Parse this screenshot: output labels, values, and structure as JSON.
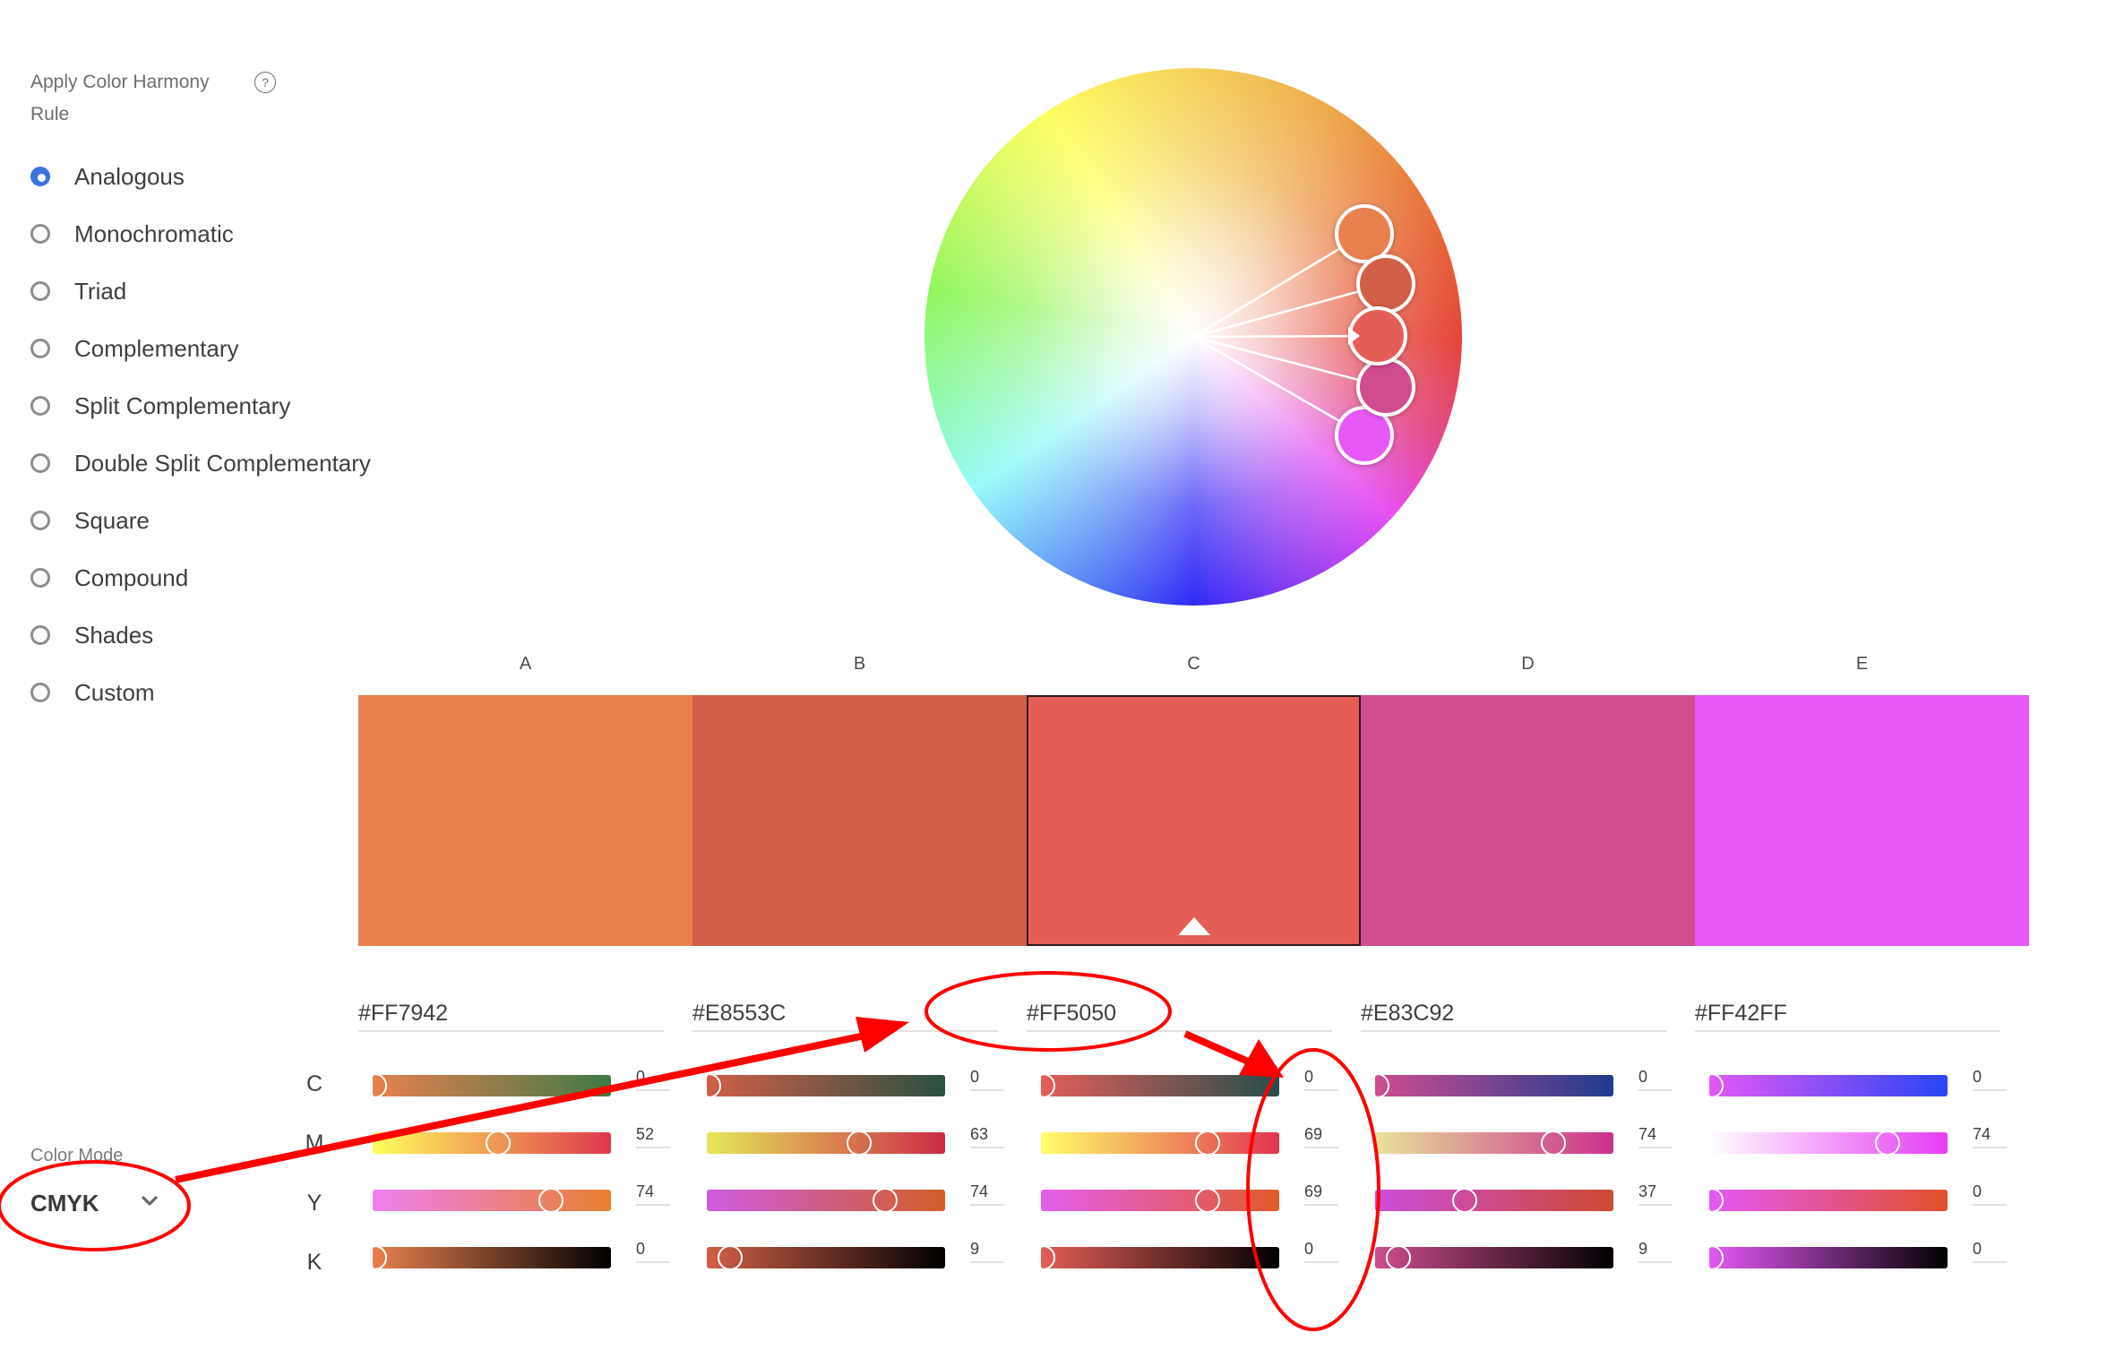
{
  "harmony": {
    "heading": "Apply Color Harmony Rule",
    "help_icon": "question-circle-icon",
    "selected": "Analogous",
    "options": [
      {
        "label": "Analogous",
        "checked": true
      },
      {
        "label": "Monochromatic",
        "checked": false
      },
      {
        "label": "Triad",
        "checked": false
      },
      {
        "label": "Complementary",
        "checked": false
      },
      {
        "label": "Split Complementary",
        "checked": false
      },
      {
        "label": "Double Split Complementary",
        "checked": false
      },
      {
        "label": "Square",
        "checked": false
      },
      {
        "label": "Compound",
        "checked": false
      },
      {
        "label": "Shades",
        "checked": false
      },
      {
        "label": "Custom",
        "checked": false
      }
    ]
  },
  "color_mode": {
    "label": "Color Mode",
    "value": "CMYK",
    "icon": "chevron-down-icon"
  },
  "channels": [
    "C",
    "M",
    "Y",
    "K"
  ],
  "selected_swatch": "C",
  "swatches": [
    {
      "letter": "A",
      "hex": "#FF7942",
      "display_color": "#E88050",
      "cmyk": [
        0,
        52,
        74,
        0
      ],
      "gradients": [
        [
          "#E8804F",
          "#3E7A45"
        ],
        [
          "#FFFF5A",
          "#E0364E"
        ],
        [
          "#EE80F0",
          "#E8802F"
        ],
        [
          "#E8804F",
          "#000000"
        ]
      ]
    },
    {
      "letter": "B",
      "hex": "#E8553C",
      "display_color": "#D15F48",
      "cmyk": [
        0,
        63,
        74,
        9
      ],
      "gradients": [
        [
          "#D15F48",
          "#2A5040"
        ],
        [
          "#E6E85A",
          "#CC2A46"
        ],
        [
          "#CE5CE0",
          "#D05E28"
        ],
        [
          "#D15F48",
          "#000000"
        ]
      ]
    },
    {
      "letter": "C",
      "hex": "#FF5050",
      "display_color": "#E45E57",
      "cmyk": [
        0,
        69,
        69,
        0
      ],
      "gradients": [
        [
          "#E45E57",
          "#244E4C"
        ],
        [
          "#FFFF6A",
          "#E2334F"
        ],
        [
          "#E45EEE",
          "#E25A2A"
        ],
        [
          "#E45E57",
          "#000000"
        ]
      ]
    },
    {
      "letter": "D",
      "hex": "#E83C92",
      "display_color": "#CF4D8F",
      "cmyk": [
        0,
        74,
        37,
        9
      ],
      "gradients": [
        [
          "#CF4D8F",
          "#1E3C8E"
        ],
        [
          "#E8E29A",
          "#CC2E8E"
        ],
        [
          "#CC4CDC",
          "#CE4A30"
        ],
        [
          "#CF4D8F",
          "#000000"
        ]
      ]
    },
    {
      "letter": "E",
      "hex": "#FF42FF",
      "display_color": "#E659F7",
      "cmyk": [
        0,
        74,
        0,
        0
      ],
      "gradients": [
        [
          "#E458F6",
          "#2845F5"
        ],
        [
          "#FFFFFF",
          "#E63CF5"
        ],
        [
          "#E458F6",
          "#E2502A"
        ],
        [
          "#E458F6",
          "#000000"
        ]
      ]
    }
  ],
  "wheel": {
    "base_hue_handle": "C",
    "handles": [
      {
        "letter": "A",
        "color": "#E88050"
      },
      {
        "letter": "B",
        "color": "#D15F48"
      },
      {
        "letter": "C",
        "color": "#E45E57"
      },
      {
        "letter": "D",
        "color": "#CF4D8F"
      },
      {
        "letter": "E",
        "color": "#E659F7"
      }
    ]
  },
  "annotation_color": "#FF0000"
}
